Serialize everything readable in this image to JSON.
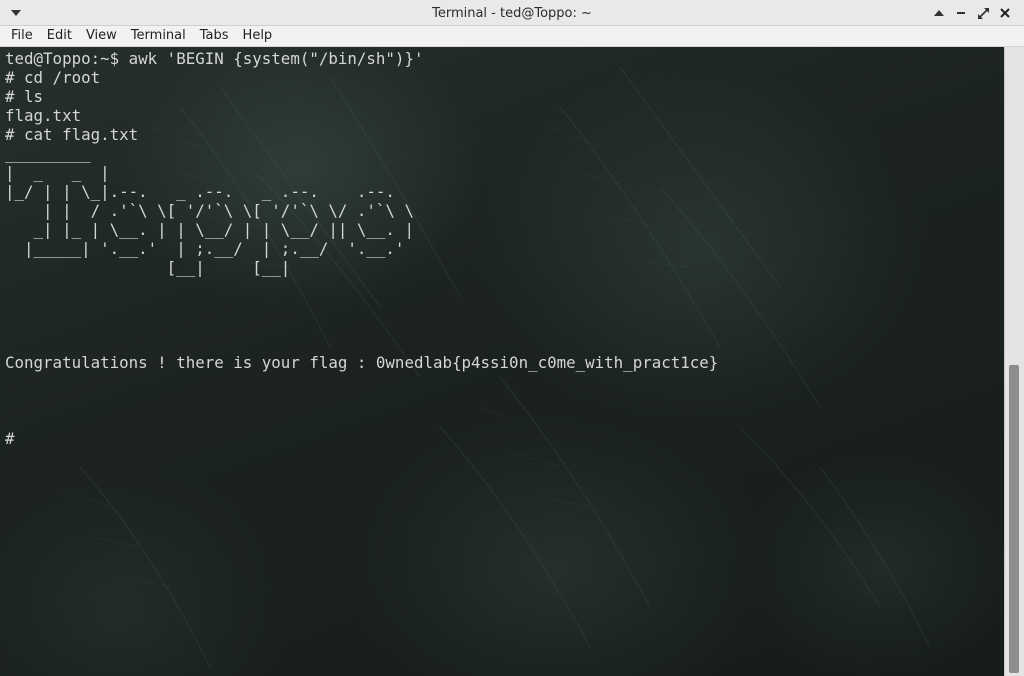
{
  "window": {
    "title": "Terminal - ted@Toppo: ~",
    "controls": {
      "menu_icon": "chevron-down-icon",
      "shade_icon": "chevron-up-icon",
      "minimize_icon": "minimize-icon",
      "maximize_icon": "maximize-icon",
      "close_icon": "close-icon"
    }
  },
  "menubar": {
    "items": [
      "File",
      "Edit",
      "View",
      "Terminal",
      "Tabs",
      "Help"
    ]
  },
  "terminal": {
    "lines": [
      "ted@Toppo:~$ awk 'BEGIN {system(\"/bin/sh\")}'",
      "# cd /root",
      "# ls",
      "flag.txt",
      "# cat flag.txt",
      "_________",
      "|  _   _  |",
      "|_/ | | \\_|.--.   _ .--.   _ .--.    .--.",
      "    | |  / .'`\\ \\[ '/'`\\ \\[ '/'`\\ \\/ .'`\\ \\",
      "   _| |_ | \\__. | | \\__/ | | \\__/ || \\__. |",
      "  |_____| '.__.'  | ;.__/  | ;.__/  '.__.'",
      "                 [__|     [__|",
      "",
      "",
      "",
      "",
      "Congratulations ! there is your flag : 0wnedlab{p4ssi0n_c0me_with_pract1ce}",
      "",
      "",
      "",
      "#"
    ]
  },
  "colors": {
    "terminal_text": "#d6d6d6",
    "titlebar_bg": "#e9e9e9",
    "menubar_bg": "#f2f2f2"
  }
}
